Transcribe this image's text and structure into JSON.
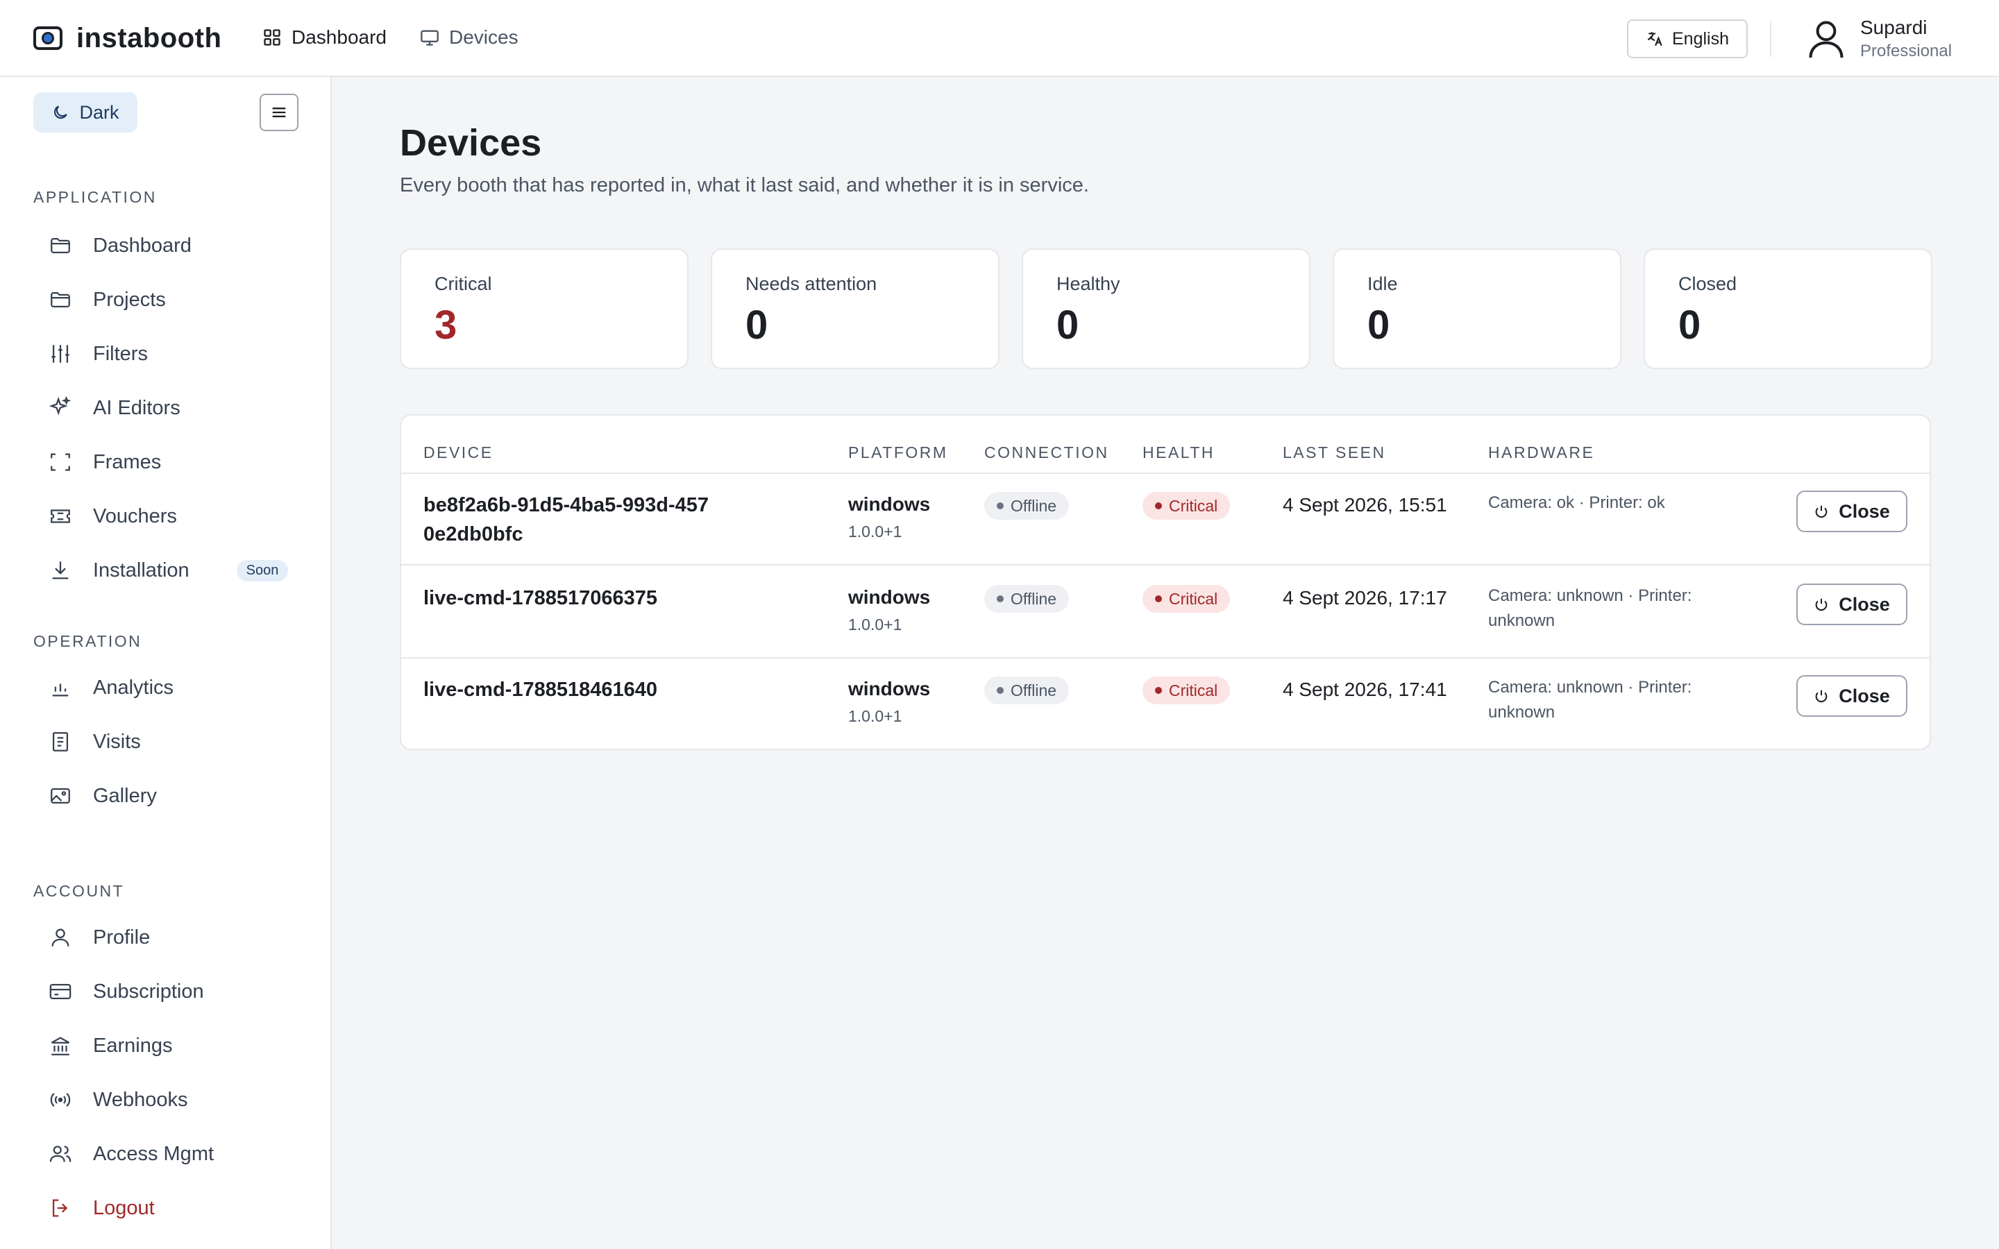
{
  "brand": {
    "name": "instabooth"
  },
  "topnav": [
    {
      "label": "Dashboard",
      "icon": "grid-icon"
    },
    {
      "label": "Devices",
      "icon": "monitor-icon"
    }
  ],
  "language": {
    "label": "English"
  },
  "user": {
    "name": "Supardi",
    "plan": "Professional"
  },
  "sidebar": {
    "theme_label": "Dark",
    "sections": [
      {
        "title": "APPLICATION",
        "items": [
          {
            "label": "Dashboard",
            "icon": "folder-icon"
          },
          {
            "label": "Projects",
            "icon": "folder-icon"
          },
          {
            "label": "Filters",
            "icon": "sliders-icon"
          },
          {
            "label": "AI Editors",
            "icon": "sparkles-icon"
          },
          {
            "label": "Frames",
            "icon": "frame-icon"
          },
          {
            "label": "Vouchers",
            "icon": "ticket-icon"
          },
          {
            "label": "Installation",
            "icon": "download-icon",
            "badge": "Soon"
          }
        ]
      },
      {
        "title": "OPERATION",
        "items": [
          {
            "label": "Analytics",
            "icon": "bar-chart-icon"
          },
          {
            "label": "Visits",
            "icon": "receipt-icon"
          },
          {
            "label": "Gallery",
            "icon": "image-icon"
          }
        ]
      },
      {
        "title": "ACCOUNT",
        "items": [
          {
            "label": "Profile",
            "icon": "user-icon"
          },
          {
            "label": "Subscription",
            "icon": "credit-card-icon"
          },
          {
            "label": "Earnings",
            "icon": "bank-icon"
          },
          {
            "label": "Webhooks",
            "icon": "broadcast-icon"
          },
          {
            "label": "Access Mgmt",
            "icon": "users-icon"
          },
          {
            "label": "Logout",
            "icon": "logout-icon"
          }
        ]
      }
    ]
  },
  "page": {
    "title": "Devices",
    "subtitle": "Every booth that has reported in, what it last said, and whether it is in service."
  },
  "stats": [
    {
      "label": "Critical",
      "value": "3"
    },
    {
      "label": "Needs attention",
      "value": "0"
    },
    {
      "label": "Healthy",
      "value": "0"
    },
    {
      "label": "Idle",
      "value": "0"
    },
    {
      "label": "Closed",
      "value": "0"
    }
  ],
  "table": {
    "headers": [
      "DEVICE",
      "PLATFORM",
      "CONNECTION",
      "HEALTH",
      "LAST SEEN",
      "HARDWARE"
    ],
    "rows": [
      {
        "device": "be8f2a6b-91d5-4ba5-993d-4570e2db0bfc",
        "platform": "windows",
        "version": "1.0.0+1",
        "connection": "Offline",
        "health": "Critical",
        "last_seen": "4 Sept 2026, 15:51",
        "hardware": "Camera: ok · Printer: ok",
        "action": "Close"
      },
      {
        "device": "live-cmd-1788517066375",
        "platform": "windows",
        "version": "1.0.0+1",
        "connection": "Offline",
        "health": "Critical",
        "last_seen": "4 Sept 2026, 17:17",
        "hardware": "Camera: unknown · Printer: unknown",
        "action": "Close"
      },
      {
        "device": "live-cmd-1788518461640",
        "platform": "windows",
        "version": "1.0.0+1",
        "connection": "Offline",
        "health": "Critical",
        "last_seen": "4 Sept 2026, 17:41",
        "hardware": "Camera: unknown · Printer: unknown",
        "action": "Close"
      }
    ]
  },
  "colors": {
    "critical": "#a1282a",
    "accent_bg": "#e3eef9"
  }
}
